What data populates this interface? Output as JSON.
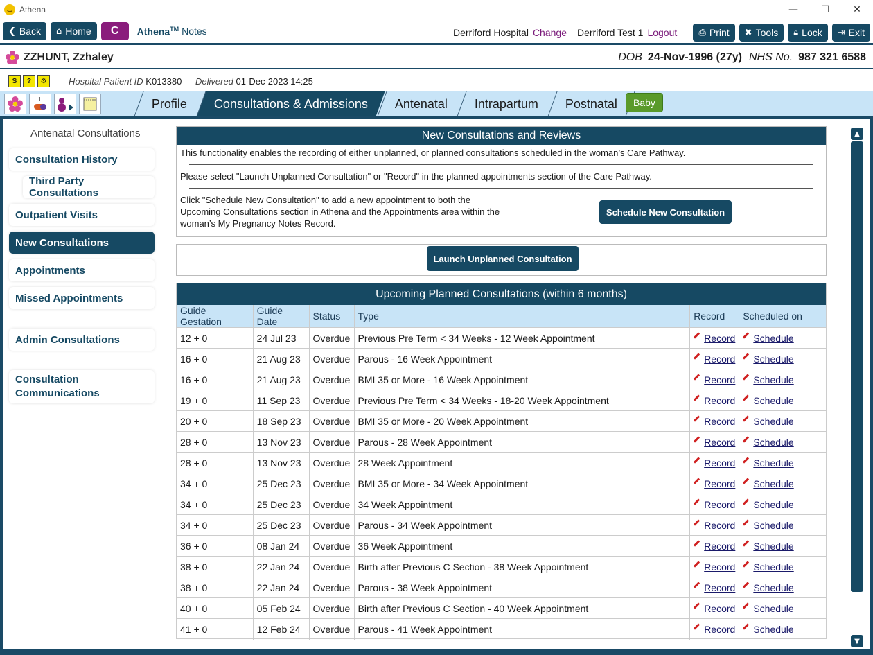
{
  "window": {
    "title": "Athena",
    "minimize": "—",
    "maximize": "☐",
    "close": "✕"
  },
  "toolbar": {
    "back": "Back",
    "home": "Home",
    "c_label": "C",
    "app_name": "Athena",
    "app_tm": "TM",
    "app_sub": "Notes",
    "hospital": "Derriford Hospital",
    "change": "Change",
    "user": "Derriford Test 1",
    "logout": "Logout",
    "print": "Print",
    "tools": "Tools",
    "lock": "Lock",
    "exit": "Exit"
  },
  "patient": {
    "name": "ZZHUNT, Zzhaley",
    "dob_label": "DOB",
    "dob": "24-Nov-1996 (27y)",
    "nhs_label": "NHS No.",
    "nhs": "987 321 6588"
  },
  "subbar": {
    "hosp_id_label": "Hospital Patient ID",
    "hosp_id": "K013380",
    "delivered_label": "Delivered",
    "delivered": "01-Dec-2023 14:25"
  },
  "tabs": [
    "Profile",
    "Consultations & Admissions",
    "Antenatal",
    "Intrapartum",
    "Postnatal"
  ],
  "baby": "Baby",
  "sidebar": {
    "title": "Antenatal Consultations",
    "items": [
      "Consultation History",
      "Third Party Consultations",
      "Outpatient Visits",
      "New Consultations",
      "Appointments",
      "Missed Appointments",
      "Admin Consultations",
      "Consultation Communications"
    ]
  },
  "new_panel": {
    "title": "New Consultations and Reviews",
    "p1": "This functionality enables the recording of either unplanned, or planned consultations scheduled in the woman’s Care Pathway.",
    "p2": "Please select \"Launch Unplanned Consultation\" or \"Record\" in the planned appointments section of the Care Pathway.",
    "p3": "Click \"Schedule New Consultation\" to add a new appointment to both the Upcoming Consultations section in Athena and the Appointments area within the woman’s My Pregnancy Notes Record.",
    "schedule_btn": "Schedule New Consultation",
    "launch_btn": "Launch Unplanned Consultation"
  },
  "upcoming": {
    "title": "Upcoming Planned Consultations (within 6 months)",
    "headers": [
      "Guide Gestation",
      "Guide Date",
      "Status",
      "Type",
      "Record",
      "Scheduled on"
    ],
    "record_link": "Record",
    "schedule_link": "Schedule",
    "rows": [
      [
        "12 + 0",
        "24 Jul 23",
        "Overdue",
        "Previous Pre Term < 34 Weeks - 12 Week Appointment"
      ],
      [
        "16 + 0",
        "21 Aug 23",
        "Overdue",
        "Parous - 16 Week Appointment"
      ],
      [
        "16 + 0",
        "21 Aug 23",
        "Overdue",
        "BMI 35 or More - 16 Week Appointment"
      ],
      [
        "19 + 0",
        "11 Sep 23",
        "Overdue",
        "Previous Pre Term < 34 Weeks - 18-20 Week Appointment"
      ],
      [
        "20 + 0",
        "18 Sep 23",
        "Overdue",
        "BMI 35 or More - 20 Week Appointment"
      ],
      [
        "28 + 0",
        "13 Nov 23",
        "Overdue",
        "Parous - 28 Week Appointment"
      ],
      [
        "28 + 0",
        "13 Nov 23",
        "Overdue",
        "28 Week Appointment"
      ],
      [
        "34 + 0",
        "25 Dec 23",
        "Overdue",
        "BMI 35 or More - 34 Week Appointment"
      ],
      [
        "34 + 0",
        "25 Dec 23",
        "Overdue",
        "34 Week Appointment"
      ],
      [
        "34 + 0",
        "25 Dec 23",
        "Overdue",
        "Parous - 34 Week Appointment"
      ],
      [
        "36 + 0",
        "08 Jan 24",
        "Overdue",
        "36 Week Appointment"
      ],
      [
        "38 + 0",
        "22 Jan 24",
        "Overdue",
        "Birth after Previous C Section - 38 Week Appointment"
      ],
      [
        "38 + 0",
        "22 Jan 24",
        "Overdue",
        "Parous - 38 Week Appointment"
      ],
      [
        "40 + 0",
        "05 Feb 24",
        "Overdue",
        "Birth after Previous C Section - 40 Week Appointment"
      ],
      [
        "41 + 0",
        "12 Feb 24",
        "Overdue",
        "Parous - 41 Week Appointment"
      ]
    ]
  },
  "colors": {
    "primary": "#164963",
    "accent": "#8a1c7c",
    "tab_bg": "#c8e4f7",
    "baby": "#5a9a2a"
  }
}
